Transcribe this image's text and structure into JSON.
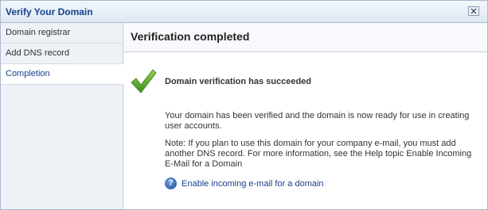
{
  "window": {
    "title": "Verify Your Domain"
  },
  "sidebar": {
    "items": [
      {
        "label": "Domain registrar"
      },
      {
        "label": "Add DNS record"
      },
      {
        "label": "Completion"
      }
    ]
  },
  "content": {
    "title": "Verification completed",
    "heading": "Domain verification has succeeded",
    "paragraph1": "Your domain has been verified and the domain is now ready for use in creating user accounts.",
    "paragraph2": "Note: If you plan to use this domain for your company e-mail, you must add another DNS record. For more information, see the Help topic Enable Incoming E-Mail for a Domain",
    "help_link": "Enable incoming e-mail for a domain",
    "help_icon_glyph": "?"
  },
  "colors": {
    "title": "#15428b",
    "success": "#5aa82b",
    "link": "#15428b"
  }
}
